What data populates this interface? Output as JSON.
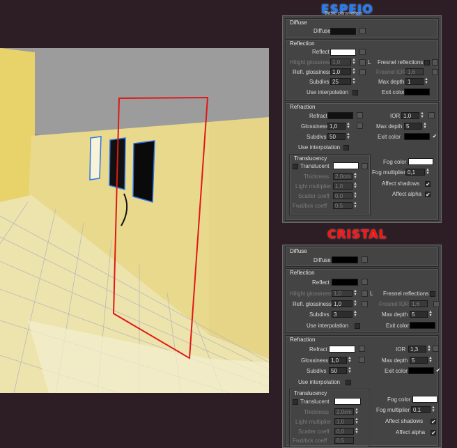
{
  "titles": {
    "espejo": "ESPEJO",
    "espejo_sub": "Basic parameters",
    "cristal": "CRISTAL"
  },
  "espejo": {
    "diffuse": {
      "title": "Diffuse",
      "label": "Diffuse",
      "color": "#111111"
    },
    "reflection": {
      "title": "Reflection",
      "reflect": "Reflect",
      "reflect_color": "#ffffff",
      "hilight": "Hilight glossiness",
      "hilight_val": "1,0",
      "L": "L",
      "fresnel": "Fresnel reflections",
      "fresnel_ior": "Fresnel IOR",
      "fresnel_ior_val": "1,6",
      "refl_gloss": "Refl. glossiness",
      "refl_gloss_val": "1,0",
      "max_depth": "Max depth",
      "max_depth_val": "1",
      "subdivs": "Subdivs",
      "subdivs_val": "25",
      "use_interp": "Use interpolation",
      "exit_color": "Exit color",
      "exit_color_val": "#000000"
    },
    "refraction": {
      "title": "Refraction",
      "refract": "Refract",
      "refract_color": "#111111",
      "ior": "IOR",
      "ior_val": "1,0",
      "glossiness": "Glossiness",
      "glossiness_val": "1,0",
      "max_depth": "Max depth",
      "max_depth_val": "5",
      "subdivs": "Subdivs",
      "subdivs_val": "50",
      "exit_color": "Exit color",
      "exit_color_val": "#000000",
      "use_interp": "Use interpolation",
      "fog_color": "Fog color",
      "fog_color_val": "#ffffff",
      "fog_mult": "Fog multiplier",
      "fog_mult_val": "0,1",
      "affect_shadows": "Affect shadows",
      "affect_alpha": "Affect alpha"
    },
    "translucency": {
      "title": "Translucency",
      "translucent": "Translucent",
      "translucent_color": "#ffffff",
      "thickness": "Thickness",
      "thickness_val": "2,0cm",
      "light_mult": "Light multiplier",
      "light_mult_val": "1,0",
      "scatter": "Scatter coeff",
      "scatter_val": "0,0",
      "fwd": "Fwd/bck coeff",
      "fwd_val": "0,5"
    }
  },
  "cristal": {
    "diffuse": {
      "title": "Diffuse",
      "label": "Diffuse",
      "color": "#000000"
    },
    "reflection": {
      "title": "Reflection",
      "reflect": "Reflect",
      "reflect_color": "#000000",
      "hilight": "Hilight glossiness",
      "hilight_val": "1,0",
      "L": "L",
      "fresnel": "Fresnel reflections",
      "fresnel_ior": "Fresnel IOR",
      "fresnel_ior_val": "1,6",
      "refl_gloss": "Refl. glossiness",
      "refl_gloss_val": "1,0",
      "max_depth": "Max depth",
      "max_depth_val": "5",
      "subdivs": "Subdivs",
      "subdivs_val": "3",
      "use_interp": "Use interpolation",
      "exit_color": "Exit color",
      "exit_color_val": "#000000"
    },
    "refraction": {
      "title": "Refraction",
      "refract": "Refract",
      "refract_color": "#ffffff",
      "ior": "IOR",
      "ior_val": "1,3",
      "glossiness": "Glossiness",
      "glossiness_val": "1,0",
      "max_depth": "Max depth",
      "max_depth_val": "5",
      "subdivs": "Subdivs",
      "subdivs_val": "50",
      "exit_color": "Exit color",
      "exit_color_val": "#000000",
      "use_interp": "Use interpolation",
      "fog_color": "Fog color",
      "fog_color_val": "#ffffff",
      "fog_mult": "Fog multiplier",
      "fog_mult_val": "0,1",
      "affect_shadows": "Affect shadows",
      "affect_alpha": "Affect alpha"
    },
    "translucency": {
      "title": "Translucency",
      "translucent": "Translucent",
      "translucent_color": "#ffffff",
      "thickness": "Thickness",
      "thickness_val": "2,0cm",
      "light_mult": "Light multiplier",
      "light_mult_val": "1,0",
      "scatter": "Scatter coeff",
      "scatter_val": "0,0",
      "fwd": "Fwd/bck coeff",
      "fwd_val": "0,5"
    }
  }
}
